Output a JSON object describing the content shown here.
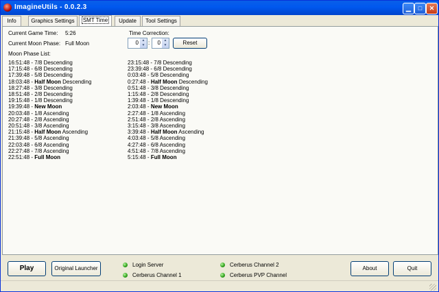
{
  "window": {
    "title": "ImagineUtils - 0.0.2.3",
    "icons": [
      "app-icon",
      "minimize-icon",
      "maximize-icon",
      "close-icon"
    ],
    "minimize_glyph": "▁",
    "maximize_glyph": "□",
    "close_glyph": "✕"
  },
  "tabs": [
    "Info",
    "Graphics Settings",
    "SMT Time",
    "Update",
    "Tool Settings"
  ],
  "active_tab": "SMT Time",
  "smt": {
    "game_time_label": "Current Game Time:",
    "game_time_value": "5:26",
    "moon_phase_label": "Current Moon Phase:",
    "moon_phase_value": "Full Moon",
    "correction_label": "Time Correction:",
    "correction_hours": "0",
    "correction_sep": ":",
    "correction_minutes": "0",
    "reset_label": "Reset",
    "list_label": "Moon Phase List:"
  },
  "phase_list_left": [
    {
      "time": "16:51:48 - ",
      "bold": "",
      "text": "7/8 Descending"
    },
    {
      "time": "17:15:48 - ",
      "bold": "",
      "text": "6/8 Descending"
    },
    {
      "time": "17:39:48 - ",
      "bold": "",
      "text": "5/8 Descending"
    },
    {
      "time": "18:03:48 - ",
      "bold": "Half Moon",
      "text": " Descending"
    },
    {
      "time": "18:27:48 - ",
      "bold": "",
      "text": "3/8 Descending"
    },
    {
      "time": "18:51:48 - ",
      "bold": "",
      "text": "2/8 Descending"
    },
    {
      "time": "19:15:48 - ",
      "bold": "",
      "text": "1/8 Descending"
    },
    {
      "time": "19:39:48 - ",
      "bold": "New Moon",
      "text": ""
    },
    {
      "time": "20:03:48 - ",
      "bold": "",
      "text": "1/8 Ascending"
    },
    {
      "time": "20:27:48 - ",
      "bold": "",
      "text": "2/8 Ascending"
    },
    {
      "time": "20:51:48 - ",
      "bold": "",
      "text": "3/8 Ascending"
    },
    {
      "time": "21:15:48 - ",
      "bold": "Half Moon",
      "text": " Ascending"
    },
    {
      "time": "21:39:48 - ",
      "bold": "",
      "text": "5/8 Ascending"
    },
    {
      "time": "22:03:48 - ",
      "bold": "",
      "text": "6/8 Ascending"
    },
    {
      "time": "22:27:48 - ",
      "bold": "",
      "text": "7/8 Ascending"
    },
    {
      "time": "22:51:48 - ",
      "bold": "Full Moon",
      "text": ""
    }
  ],
  "phase_list_right": [
    {
      "time": "23:15:48 - ",
      "bold": "",
      "text": "7/8 Descending"
    },
    {
      "time": "23:39:48 - ",
      "bold": "",
      "text": "6/8 Descending"
    },
    {
      "time": "0:03:48 - ",
      "bold": "",
      "text": "5/8 Descending"
    },
    {
      "time": "0:27:48 - ",
      "bold": "Half Moon",
      "text": " Descending"
    },
    {
      "time": "0:51:48 - ",
      "bold": "",
      "text": "3/8 Descending"
    },
    {
      "time": "1:15:48 - ",
      "bold": "",
      "text": "2/8 Descending"
    },
    {
      "time": "1:39:48 - ",
      "bold": "",
      "text": "1/8 Descending"
    },
    {
      "time": "2:03:48 - ",
      "bold": "New Moon",
      "text": ""
    },
    {
      "time": "2:27:48 - ",
      "bold": "",
      "text": "1/8 Ascending"
    },
    {
      "time": "2:51:48 - ",
      "bold": "",
      "text": "2/8 Ascending"
    },
    {
      "time": "3:15:48 - ",
      "bold": "",
      "text": "3/8 Ascending"
    },
    {
      "time": "3:39:48 - ",
      "bold": "Half Moon",
      "text": " Ascending"
    },
    {
      "time": "4:03:48 - ",
      "bold": "",
      "text": "5/8 Ascending"
    },
    {
      "time": "4:27:48 - ",
      "bold": "",
      "text": "6/8 Ascending"
    },
    {
      "time": "4:51:48 - ",
      "bold": "",
      "text": "7/8 Ascending"
    },
    {
      "time": "5:15:48 - ",
      "bold": "Full Moon",
      "text": ""
    }
  ],
  "bottom": {
    "play_label": "Play",
    "launcher_label": "Original Launcher",
    "about_label": "About",
    "quit_label": "Quit",
    "servers": [
      {
        "name": "Login Server",
        "status_color": "#2ea01a"
      },
      {
        "name": "Cerberus Channel 1",
        "status_color": "#2ea01a"
      },
      {
        "name": "Cerberus Channel 2",
        "status_color": "#2ea01a"
      },
      {
        "name": "Cerberus PVP Channel",
        "status_color": "#2ea01a"
      }
    ]
  }
}
